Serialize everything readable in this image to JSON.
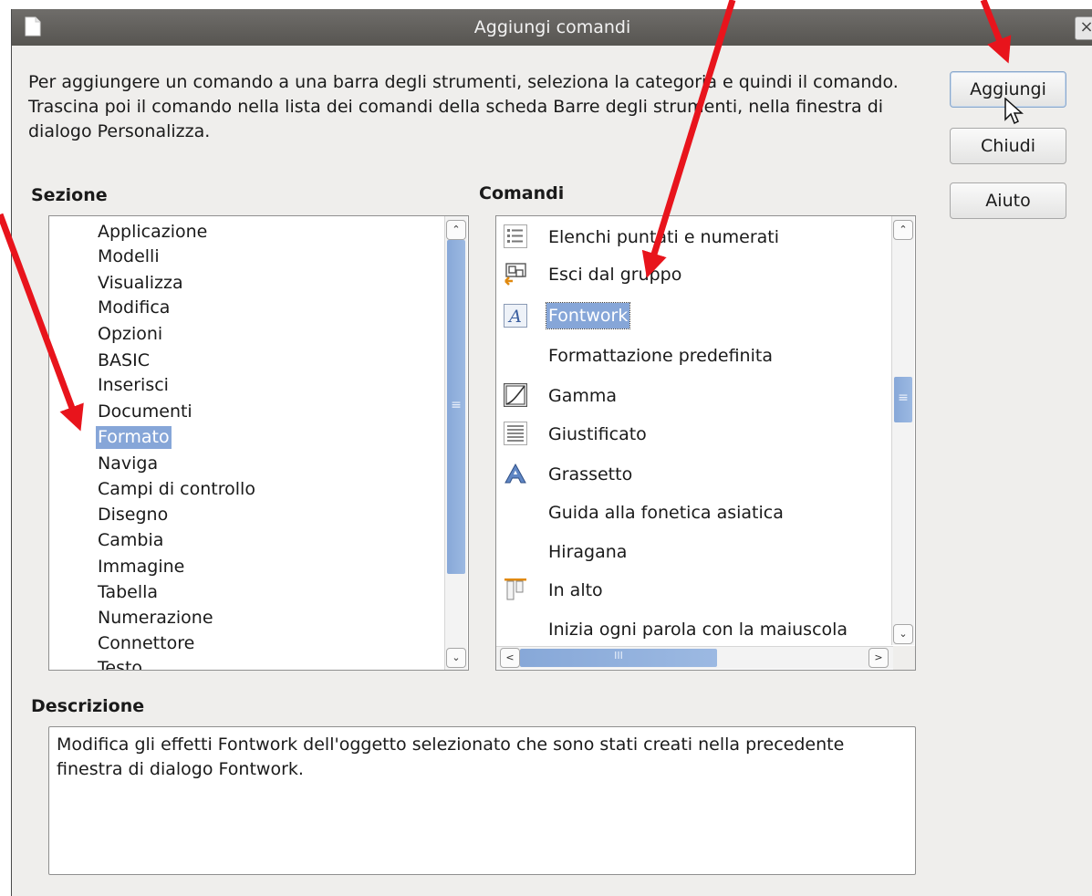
{
  "window": {
    "title": "Aggiungi comandi",
    "close_glyph": "×"
  },
  "intro_text": "Per aggiungere un comando a una barra degli strumenti, seleziona la categoria e quindi il comando. Trascina poi il comando nella lista dei comandi della scheda Barre degli strumenti, nella finestra di dialogo Personalizza.",
  "buttons": {
    "add": "Aggiungi",
    "close": "Chiudi",
    "help": "Aiuto"
  },
  "sezione": {
    "label": "Sezione",
    "selected": "Formato",
    "items": [
      "Applicazione",
      "Modelli",
      "Visualizza",
      "Modifica",
      "Opzioni",
      "BASIC",
      "Inserisci",
      "Documenti",
      "Formato",
      "Naviga",
      "Campi di controllo",
      "Disegno",
      "Cambia",
      "Immagine",
      "Tabella",
      "Numerazione",
      "Connettore",
      "Testo"
    ]
  },
  "comandi": {
    "label": "Comandi",
    "selected": "Fontwork",
    "items": [
      {
        "label": "Elenchi puntati e numerati",
        "icon": "bullet-list-icon"
      },
      {
        "label": "Esci dal gruppo",
        "icon": "exit-group-icon"
      },
      {
        "label": "Fontwork",
        "icon": "fontwork-icon"
      },
      {
        "label": "Formattazione predefinita",
        "icon": ""
      },
      {
        "label": "Gamma",
        "icon": "gamma-icon"
      },
      {
        "label": "Giustificato",
        "icon": "justify-icon"
      },
      {
        "label": "Grassetto",
        "icon": "bold-icon"
      },
      {
        "label": "Guida alla fonetica asiatica",
        "icon": ""
      },
      {
        "label": "Hiragana",
        "icon": ""
      },
      {
        "label": "In alto",
        "icon": "align-top-icon"
      },
      {
        "label": "Inizia ogni parola con la maiuscola",
        "icon": ""
      }
    ]
  },
  "descrizione": {
    "label": "Descrizione",
    "text": "Modifica gli effetti Fontwork dell'oggetto selezionato che sono stati creati nella precedente finestra di dialogo Fontwork."
  },
  "scrollbar_glyphs": {
    "up": "⌃",
    "down": "⌄",
    "left": "<",
    "right": ">",
    "grip_v": "≡",
    "grip_h": "III"
  },
  "accent_colors": {
    "selection": "#86a6d8",
    "annotation_arrow": "#e8141c"
  }
}
